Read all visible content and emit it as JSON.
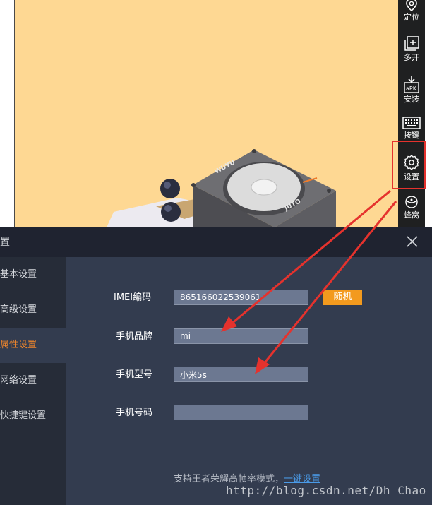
{
  "toolbar": {
    "items": [
      {
        "label": "定位",
        "icon": "location-pin-icon"
      },
      {
        "label": "多开",
        "icon": "multi-window-icon"
      },
      {
        "label": "安装",
        "icon": "apk-install-icon",
        "badge": "aPK"
      },
      {
        "label": "按键",
        "icon": "keyboard-icon"
      },
      {
        "label": "设置",
        "icon": "gear-icon"
      },
      {
        "label": "蜂窝",
        "icon": "hive-icon"
      }
    ]
  },
  "game": {
    "box_text_left": "WUYU",
    "box_text_right": "JUTO"
  },
  "dialog": {
    "title": "置",
    "sidebar": {
      "items": [
        {
          "label": "基本设置",
          "active": false
        },
        {
          "label": "高级设置",
          "active": false
        },
        {
          "label": "属性设置",
          "active": true
        },
        {
          "label": "网络设置",
          "active": false
        },
        {
          "label": "快捷键设置",
          "active": false
        }
      ]
    },
    "fields": {
      "imei": {
        "label": "IMEI编码",
        "value": "865166022539061"
      },
      "brand": {
        "label": "手机品牌",
        "value": "mi"
      },
      "model": {
        "label": "手机型号",
        "value": "小米5s"
      },
      "phone": {
        "label": "手机号码",
        "value": ""
      }
    },
    "random_button": "随机",
    "support_text": "支持王者荣耀高帧率模式，",
    "support_link": "一键设置"
  },
  "watermark": "http://blog.csdn.net/Dh_Chao",
  "colors": {
    "toolbar_bg": "#1f2021",
    "dialog_bg": "#333c4f",
    "sidebar_bg": "#262c38",
    "active_orange": "#f0862b",
    "random_btn": "#f39a1e",
    "input_bg": "#6c7891",
    "link_blue": "#4a9be8",
    "highlight_red": "#e5322d",
    "game_bg": "#fed893"
  }
}
